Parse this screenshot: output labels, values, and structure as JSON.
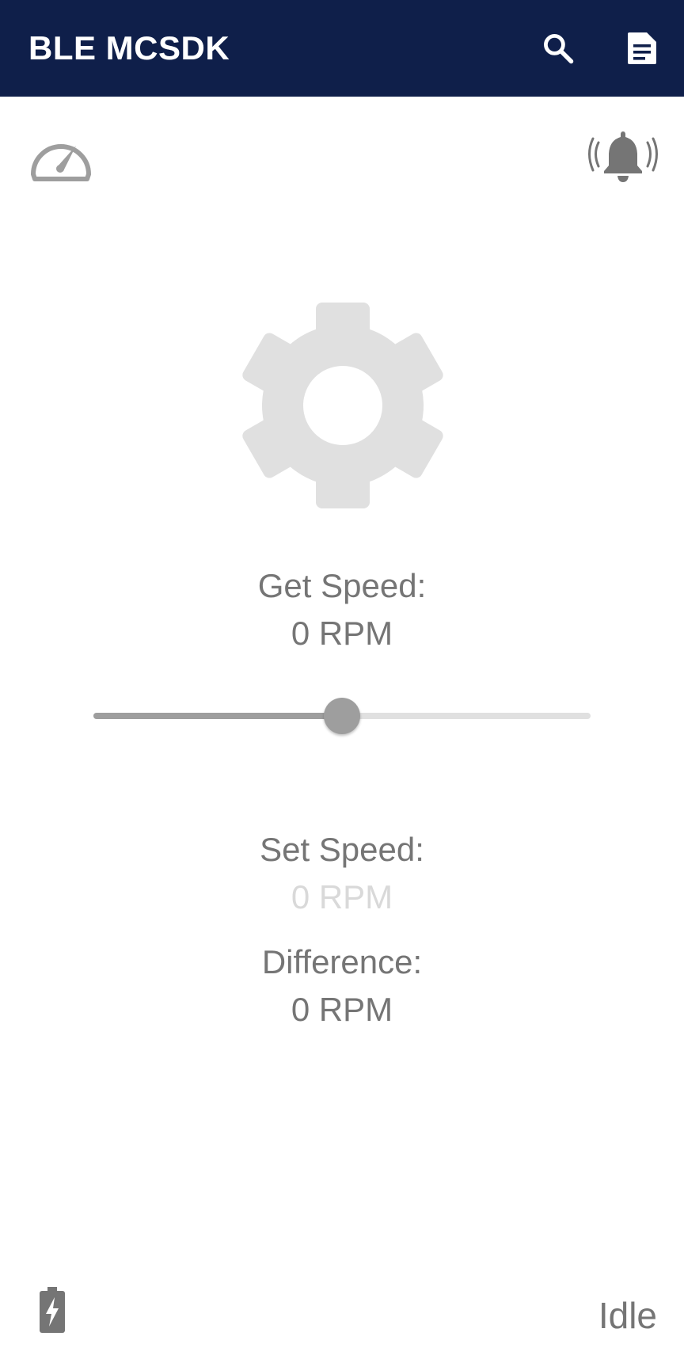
{
  "app_bar": {
    "title": "BLE MCSDK",
    "background_color": "#0f1f4a",
    "actions": [
      {
        "icon": "search-icon"
      },
      {
        "icon": "document-icon"
      }
    ]
  },
  "top_icons": {
    "left": "speedometer-icon",
    "right": "ringing-bell-icon"
  },
  "center_icon": "gear-icon",
  "get_speed": {
    "label": "Get Speed:",
    "value": "0 RPM"
  },
  "speed_slider": {
    "position_fraction": 0.5
  },
  "set_speed": {
    "label": "Set Speed:",
    "value": "0 RPM"
  },
  "difference": {
    "label": "Difference:",
    "value": "0 RPM"
  },
  "footer": {
    "battery_icon": "battery-charging-icon",
    "status": "Idle"
  }
}
